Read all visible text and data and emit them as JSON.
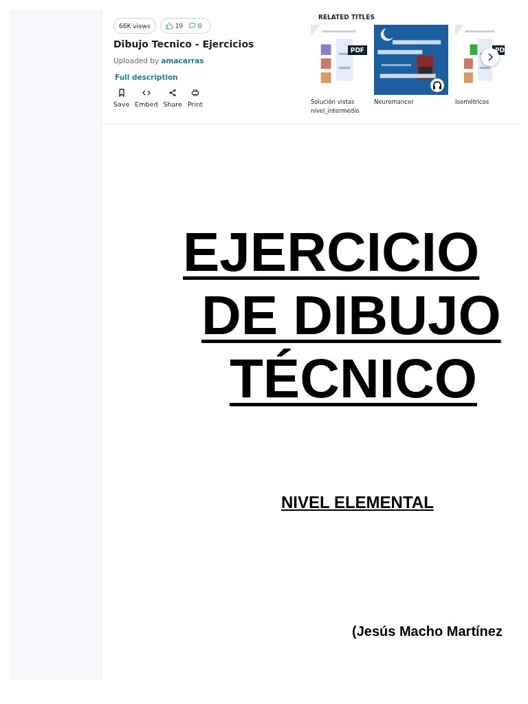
{
  "stats": {
    "views": "66K views",
    "likes": "19",
    "comments": "0"
  },
  "title": "Dibujo Tecnico - Ejercicios",
  "uploaded": {
    "prefix": "Uploaded by",
    "user": "amacarras"
  },
  "full_description": "Full description",
  "actions": [
    {
      "kind": "save",
      "label": "Save"
    },
    {
      "kind": "embed",
      "label": "Embed"
    },
    {
      "kind": "share",
      "label": "Share"
    },
    {
      "kind": "print",
      "label": "Print"
    }
  ],
  "related": {
    "heading": "RELATED TITLES",
    "items": [
      {
        "title": "Solución vistas nivel_intermedio",
        "badge": "PDF",
        "kind": "doc"
      },
      {
        "title": "Neuromancer",
        "kind": "audio"
      },
      {
        "title": "Isométricos",
        "badge": "PD",
        "kind": "doc2"
      }
    ]
  },
  "document": {
    "title_lines": [
      "EJERCICIO",
      "DE DIBUJO",
      "TÉCNICO"
    ],
    "subtitle": "NIVEL ELEMENTAL",
    "author": "(Jesús Macho Martínez"
  }
}
